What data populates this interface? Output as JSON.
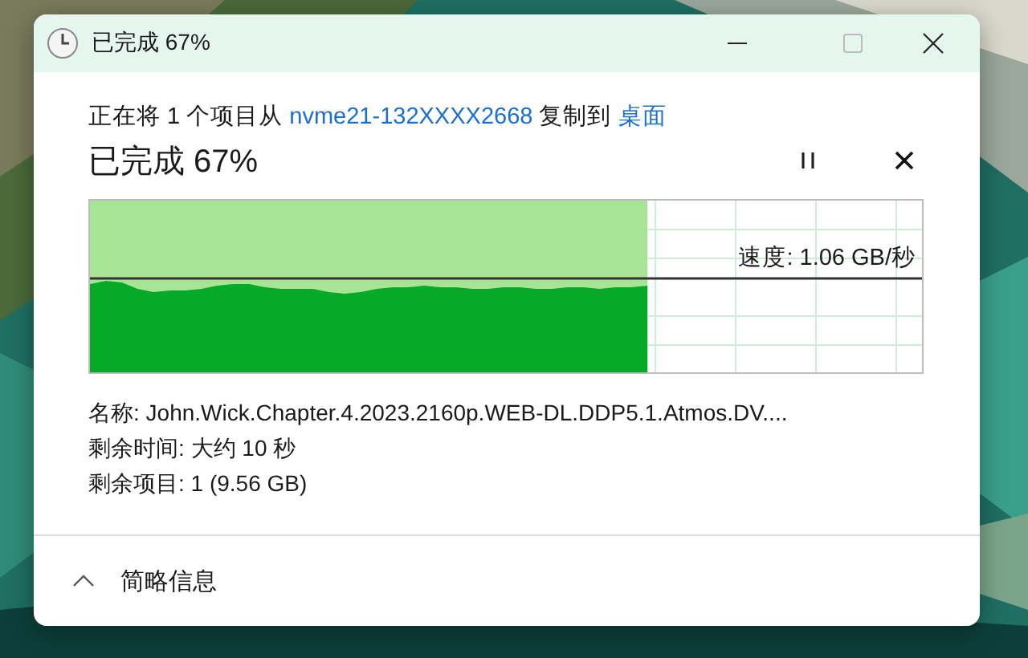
{
  "window": {
    "title": "已完成 67%"
  },
  "description": [
    {
      "kind": "text",
      "text": "正在将 1 个项目从 "
    },
    {
      "kind": "link",
      "text": "nvme21-132XXXX2668"
    },
    {
      "kind": "text",
      "text": " 复制到 "
    },
    {
      "kind": "link",
      "text": "桌面"
    }
  ],
  "status": "已完成 67%",
  "progress": {
    "level": 0.67,
    "speed": "速度: 1.06 GB/秒"
  },
  "details": [
    "名称:  John.Wick.Chapter.4.2023.2160p.WEB-DL.DDP5.1.Atmos.DV....",
    "剩余时间: 大约 10 秒",
    "剩余项目: 1 (9.56 GB)"
  ],
  "footer": {
    "label": "简略信息",
    "expanded": true
  }
}
